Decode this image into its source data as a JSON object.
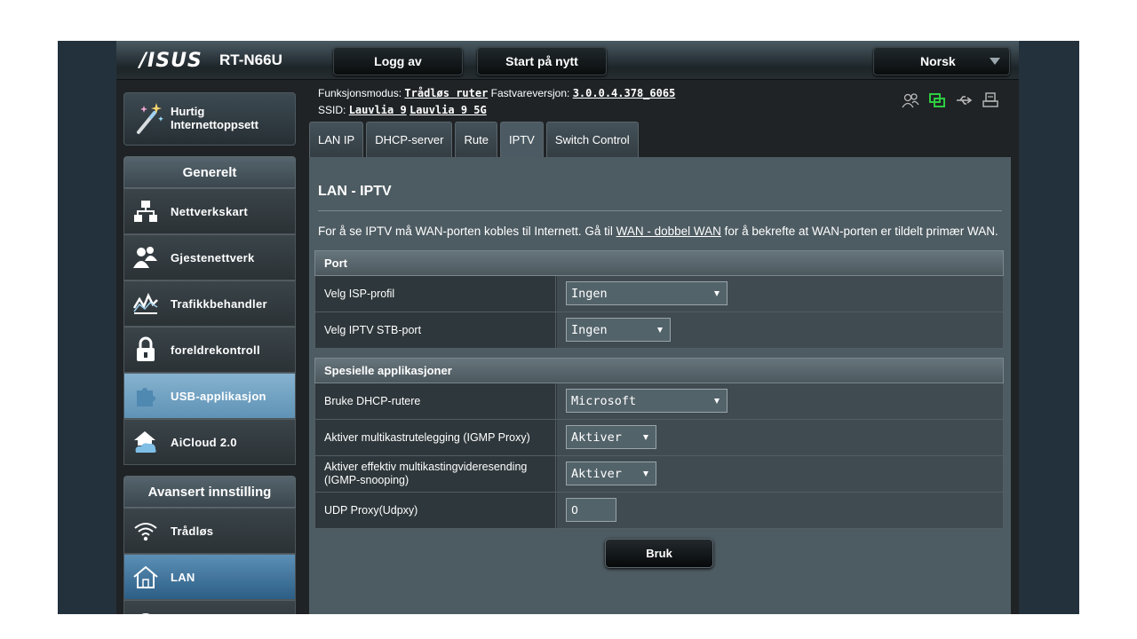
{
  "brand": {
    "logo": "/ISUS",
    "model": "RT-N66U"
  },
  "topbar": {
    "logout": "Logg av",
    "restart": "Start på nytt",
    "language": "Norsk"
  },
  "quick_setup": {
    "line1": "Hurtig",
    "line2": "Internettoppsett"
  },
  "sidebar": {
    "general_header": "Generelt",
    "general_items": [
      {
        "label": "Nettverkskart",
        "icon": "network-map-icon"
      },
      {
        "label": "Gjestenettverk",
        "icon": "guest-network-icon"
      },
      {
        "label": "Trafikkbehandler",
        "icon": "traffic-manager-icon"
      },
      {
        "label": "foreldrekontroll",
        "icon": "parental-control-icon"
      },
      {
        "label": "USB-applikasjon",
        "icon": "usb-app-icon"
      },
      {
        "label": "AiCloud 2.0",
        "icon": "aicloud-icon"
      }
    ],
    "advanced_header": "Avansert innstilling",
    "advanced_items": [
      {
        "label": "Trådløs",
        "icon": "wireless-icon"
      },
      {
        "label": "LAN",
        "icon": "lan-home-icon"
      }
    ]
  },
  "info": {
    "mode_label": "Funksjonsmodus:",
    "mode_value": "Trådløs ruter",
    "fw_label": "Fastvareversjon:",
    "fw_value": "3.0.0.4.378_6065",
    "ssid_label": "SSID:",
    "ssid1": "Lauvlia 9",
    "ssid2": "Lauvlia 9 5G"
  },
  "status_icons": [
    "clients-icon",
    "network-status-icon",
    "usb-status-icon",
    "printer-icon"
  ],
  "tabs": [
    "LAN IP",
    "DHCP-server",
    "Rute",
    "IPTV",
    "Switch Control"
  ],
  "active_tab": "IPTV",
  "content": {
    "title": "LAN - IPTV",
    "desc_before": "For å se IPTV må WAN-porten kobles til Internett. Gå til ",
    "desc_link": "WAN - dobbel WAN",
    "desc_after": " for å bekrefte at WAN-porten er tildelt primær WAN.",
    "port_header": "Port",
    "isp_label": "Velg ISP-profil",
    "isp_value": "Ingen",
    "stb_label": "Velg IPTV STB-port",
    "stb_value": "Ingen",
    "special_header": "Spesielle applikasjoner",
    "dhcp_label": "Bruke DHCP-rutere",
    "dhcp_value": "Microsoft",
    "igmp_label": "Aktiver multikastrutelegging (IGMP Proxy)",
    "igmp_value": "Aktiver",
    "snoop_label_1": "Aktiver effektiv multikastingvideresending",
    "snoop_label_2": "(IGMP-snooping)",
    "snoop_value": "Aktiver",
    "udp_label": "UDP Proxy(Udpxy)",
    "udp_value": "0",
    "apply": "Bruk"
  },
  "colors": {
    "active_nav": "#86b2cf",
    "accent_green": "#2ecc40",
    "background": "#23313c"
  }
}
